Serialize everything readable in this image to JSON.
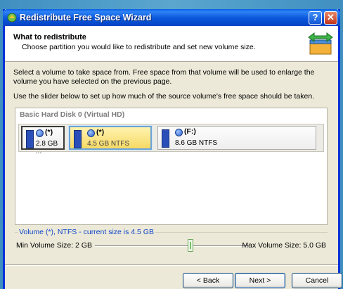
{
  "window": {
    "title": "Redistribute Free Space Wizard",
    "help_label": "?",
    "close_label": "✕"
  },
  "header": {
    "title": "What to redistribute",
    "subtitle": "Choose partition you would like to redistribute and set new volume size."
  },
  "body": {
    "description": "Select a volume to take space from. Free space from that volume will be used to enlarge the volume you have selected on the previous page.",
    "slider_hint": "Use the slider below to set up how much of the source volume's free space should be taken."
  },
  "disk": {
    "title": "Basic Hard Disk 0 (Virtual HD)",
    "partitions": [
      {
        "label": "(*)",
        "size": "2.8 GB ..."
      },
      {
        "label": "(*)",
        "size": "4.5 GB NTFS"
      },
      {
        "label": "(F:)",
        "size": "8.6 GB NTFS"
      }
    ]
  },
  "volume": {
    "legend": "Volume (*), NTFS - current size is 4.5 GB",
    "min_label": "Min Volume Size:  2 GB",
    "max_label": "Max Volume Size:  5.0 GB",
    "slider_fraction": 0.62
  },
  "buttons": {
    "back": "< Back",
    "next": "Next >",
    "cancel": "Cancel"
  },
  "colors": {
    "titlebar": "#0a56da",
    "selected_partition": "#f6d964",
    "legend_text": "#1046c8"
  }
}
